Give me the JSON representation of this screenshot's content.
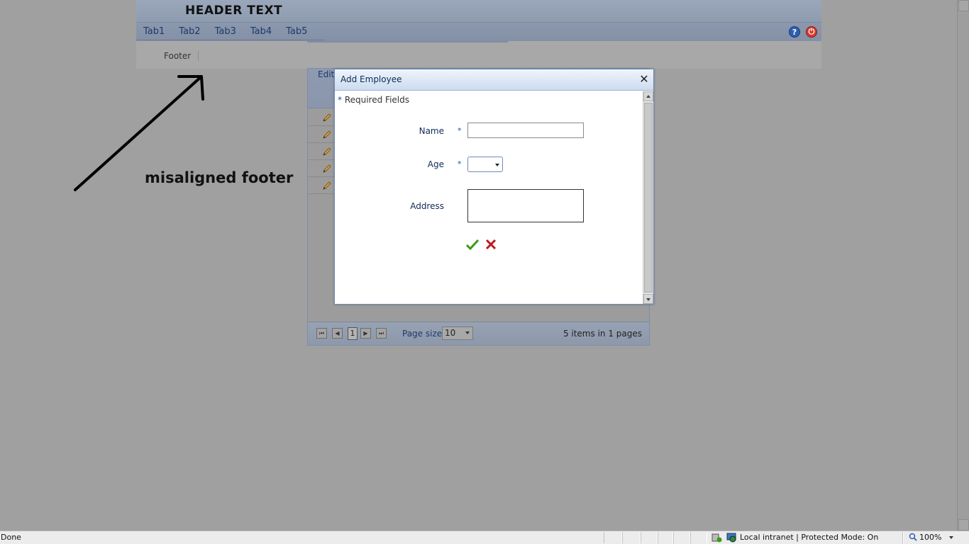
{
  "header": {
    "title": "HEADER TEXT",
    "tabs": [
      {
        "label": "Tab1"
      },
      {
        "label": "Tab2"
      },
      {
        "label": "Tab3"
      },
      {
        "label": "Tab4"
      },
      {
        "label": "Tab5"
      }
    ],
    "icons": {
      "help": "?",
      "power": "⏻"
    }
  },
  "footer": {
    "label": "Footer"
  },
  "grid": {
    "edit_label": "Edit",
    "pager": {
      "current_page": "1",
      "page_size_label": "Page size:",
      "page_size_value": "10",
      "items_info": "5 items in 1 pages",
      "first": "⏮",
      "prev": "◀",
      "next": "▶",
      "last": "⏭"
    }
  },
  "modal": {
    "title": "Add Employee",
    "close": "✕",
    "required_note_star": "*",
    "required_note_text": " Required Fields",
    "fields": {
      "name_label": "Name",
      "age_label": "Age",
      "address_label": "Address",
      "required_star": "*"
    }
  },
  "annotation": {
    "text": "misaligned footer"
  },
  "statusbar": {
    "left_text": "Done",
    "zone_text": "Local intranet | Protected Mode: On",
    "zoom_text": "100%"
  }
}
